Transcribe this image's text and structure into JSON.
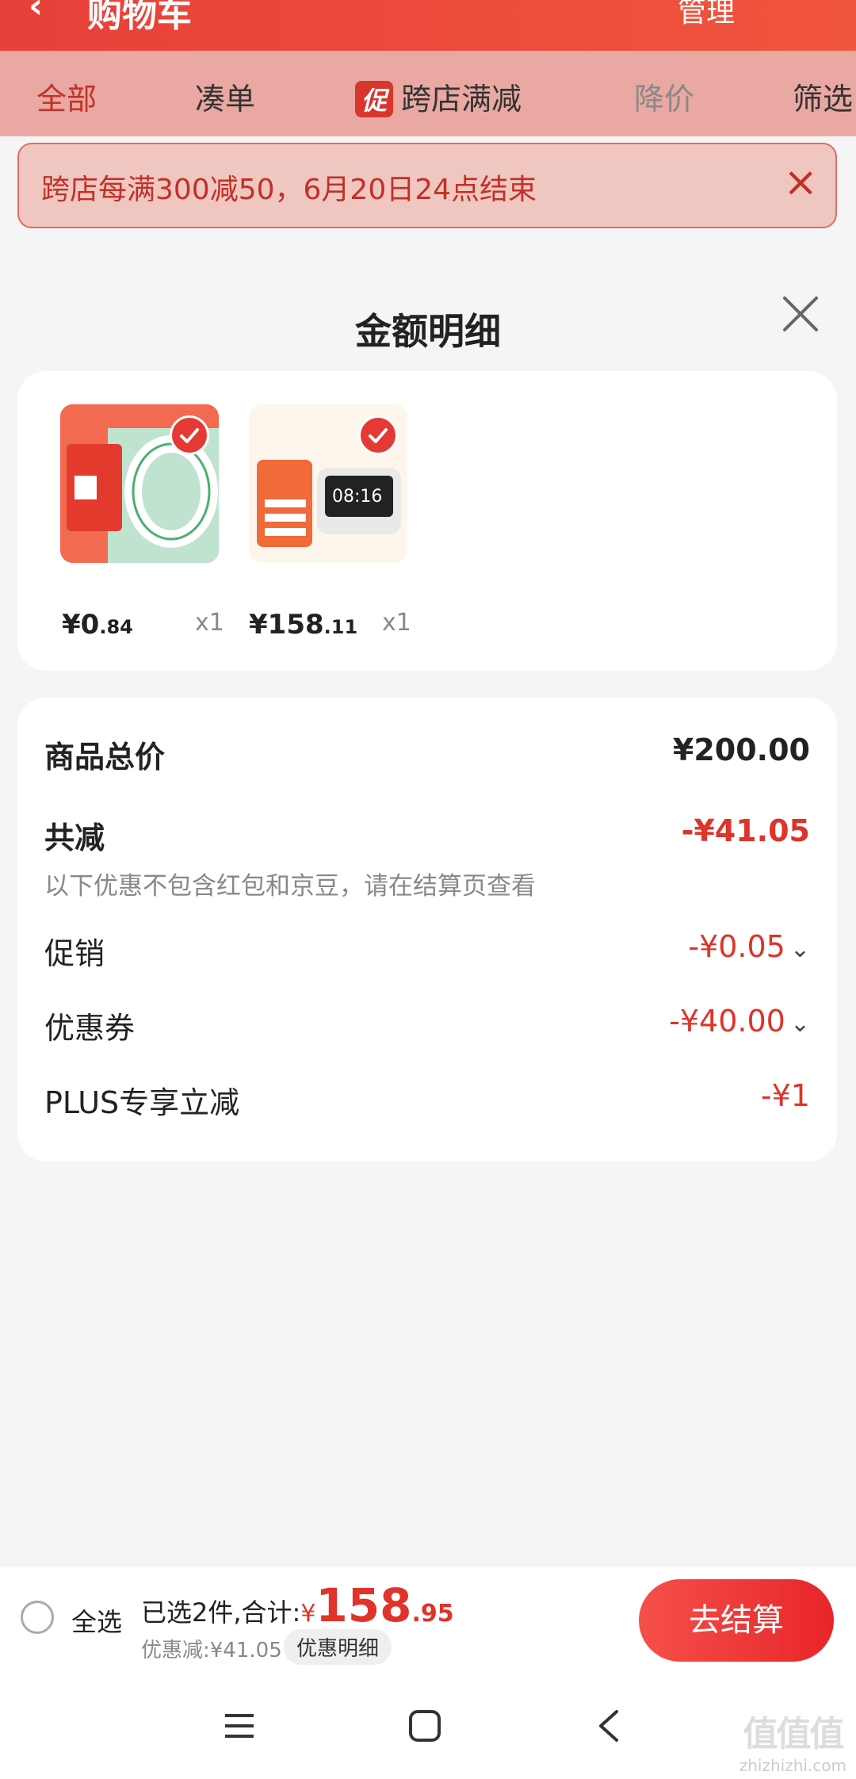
{
  "header": {
    "title": "购物车",
    "manage_label": "管理"
  },
  "tabs": [
    {
      "label": "全部",
      "active": true
    },
    {
      "label": "凑单"
    },
    {
      "badge": "促",
      "label": "跨店满减"
    },
    {
      "label": "降价"
    },
    {
      "label": "筛选"
    }
  ],
  "promo_banner": {
    "text": "跨店每满300减50，6月20日24点结束"
  },
  "sheet": {
    "title": "金额明细",
    "items": [
      {
        "price_int": "¥0",
        "price_dec": ".84",
        "qty": "x1",
        "icon": "tape-product-image"
      },
      {
        "price_int": "¥158",
        "price_dec": ".11",
        "qty": "x1",
        "icon": "smart-speaker-product-image"
      }
    ],
    "summary": {
      "total_label": "商品总价",
      "total_value": "¥200.00",
      "discount_label": "共减",
      "discount_value": "-¥41.05",
      "note": "以下优惠不包含红包和京豆，请在结算页查看",
      "rows": [
        {
          "label": "促销",
          "value": "-¥0.05",
          "expandable": true
        },
        {
          "label": "优惠券",
          "value": "-¥40.00",
          "expandable": true
        },
        {
          "label": "PLUS专享立减",
          "value": "-¥1",
          "expandable": false
        }
      ]
    }
  },
  "bottom_bar": {
    "select_all": "全选",
    "selected_text": "已选2件,合计:",
    "currency": "¥",
    "total_int": "158",
    "total_dec": ".95",
    "discount_text": "优惠减:¥41.05",
    "detail_label": "优惠明细",
    "checkout_label": "去结算"
  },
  "watermark": {
    "text": "zhizhizhi.com"
  },
  "colors": {
    "accent_red": "#e0332a",
    "header_red": "#e8403a"
  }
}
